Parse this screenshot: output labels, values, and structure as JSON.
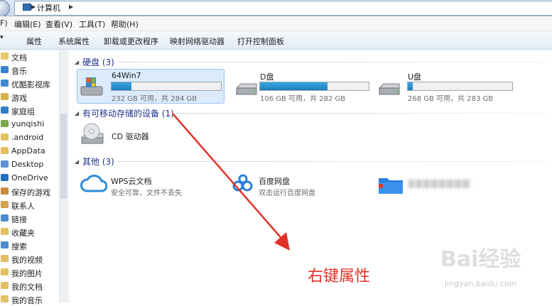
{
  "address_bar": {
    "crumb": "计算机"
  },
  "menu": [
    "F)",
    "编辑(E)",
    "查看(V)",
    "工具(T)",
    "帮助(H)"
  ],
  "toolbar": [
    "属性",
    "系统属性",
    "卸载或更改程序",
    "映射网络驱动器",
    "打开控制面板"
  ],
  "sidebar": [
    {
      "label": "文档",
      "icon": "documents-icon",
      "color": "#e8c86a"
    },
    {
      "label": "音乐",
      "icon": "music-icon",
      "color": "#3b7fd1"
    },
    {
      "label": "优酷影视库",
      "icon": "video-library-icon",
      "color": "#3a8ad8"
    },
    {
      "label": "游戏",
      "icon": "games-icon",
      "color": "#d9b24c"
    },
    {
      "label": "家庭组",
      "icon": "homegroup-icon",
      "color": "#2c7ec9"
    },
    {
      "label": "yunqishi",
      "icon": "user-icon",
      "color": "#7aa84a"
    },
    {
      "label": ".android",
      "icon": "folder-icon",
      "color": "#e4c061"
    },
    {
      "label": "AppData",
      "icon": "folder-icon",
      "color": "#e4c061"
    },
    {
      "label": "Desktop",
      "icon": "desktop-folder-icon",
      "color": "#5b8fd6"
    },
    {
      "label": "OneDrive",
      "icon": "onedrive-icon",
      "color": "#1f6fc4"
    },
    {
      "label": "保存的游戏",
      "icon": "saved-games-icon",
      "color": "#c98a3b"
    },
    {
      "label": "联系人",
      "icon": "contacts-icon",
      "color": "#d7a24d"
    },
    {
      "label": "链接",
      "icon": "links-icon",
      "color": "#4b8bd2"
    },
    {
      "label": "收藏夹",
      "icon": "favorites-icon",
      "color": "#e4c061"
    },
    {
      "label": "搜索",
      "icon": "searches-icon",
      "color": "#4b8bd2"
    },
    {
      "label": "我的视频",
      "icon": "my-videos-icon",
      "color": "#e4c061"
    },
    {
      "label": "我的图片",
      "icon": "my-pictures-icon",
      "color": "#e4c061"
    },
    {
      "label": "我的文档",
      "icon": "my-documents-icon",
      "color": "#e4c061"
    },
    {
      "label": "我的音乐",
      "icon": "my-music-icon",
      "color": "#e4c061"
    }
  ],
  "groups": {
    "hard_disks": "硬盘 (3)",
    "removable": "有可移动存储的设备 (1)",
    "other": "其他 (3)"
  },
  "drives": [
    {
      "name": "64Win7",
      "info": "232 GB 可用，共 284 GB",
      "used_fraction": 0.18,
      "icon": "system-drive-icon"
    },
    {
      "name": "D盘",
      "info": "106 GB 可用，共 282 GB",
      "used_fraction": 0.62,
      "icon": "hard-drive-icon"
    },
    {
      "name": "U盘",
      "info": "268 GB 可用，共 283 GB",
      "used_fraction": 0.05,
      "icon": "hard-drive-icon"
    }
  ],
  "cd_drive": {
    "name": "CD 驱动器",
    "icon": "cd-drive-icon"
  },
  "others": [
    {
      "name": "WPS云文档",
      "sub": "安全可靠，文件不丢失",
      "icon": "wps-cloud-icon"
    },
    {
      "name": "百度网盘",
      "sub": "双击运行百度网盘",
      "icon": "baidu-netdisk-icon"
    },
    {
      "name": "",
      "sub": "",
      "icon": "blurred-folder-icon"
    }
  ],
  "annotation": "右键属性",
  "watermark": {
    "main": "Bai经验",
    "url": "jingyan.baidu.com"
  },
  "colors": {
    "accent": "#1b7fbf",
    "annotation": "#e2312a",
    "group_title": "#1e3287"
  }
}
